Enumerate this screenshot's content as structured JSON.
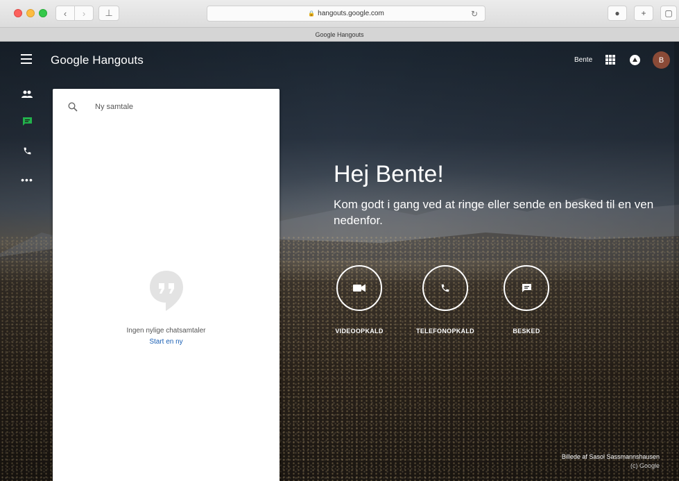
{
  "browser": {
    "url": "hangouts.google.com",
    "tab_title": "Google Hangouts",
    "back_glyph": "‹",
    "forward_glyph": "›",
    "sidebar_glyph": "⊥",
    "reload_glyph": "↻",
    "plus_glyph": "+",
    "tabs_glyph": "▢",
    "privacy_glyph": "●"
  },
  "header": {
    "brand": "Google Hangouts",
    "user_name": "Bente",
    "avatar_initial": "B",
    "avatar_color": "#8a4a37"
  },
  "nav": {
    "accent_color": "#22b14c",
    "items": [
      {
        "icon": "people-icon",
        "active": false
      },
      {
        "icon": "chat-icon",
        "active": true
      },
      {
        "icon": "phone-icon",
        "active": false
      },
      {
        "icon": "more-icon",
        "label": "•••"
      }
    ]
  },
  "conversations": {
    "search_placeholder": "Ny samtale",
    "empty_message": "Ingen nylige chatsamtaler",
    "start_link": "Start en ny"
  },
  "welcome": {
    "greeting": "Hej Bente!",
    "subtext": "Kom godt i gang ved at ringe eller sende en besked til en ven nedenfor.",
    "actions": [
      {
        "icon": "video-icon",
        "label": "VIDEOOPKALD"
      },
      {
        "icon": "phone-icon",
        "label": "TELEFONOPKALD"
      },
      {
        "icon": "message-icon",
        "label": "BESKED"
      }
    ]
  },
  "credit": {
    "line1": "Billede af Sasol Sassmannshausen",
    "line2": "(c) Google"
  }
}
